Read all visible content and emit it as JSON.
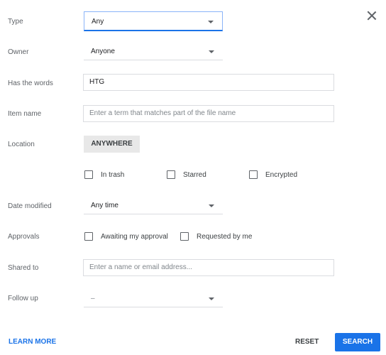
{
  "close_icon": "close-icon",
  "fields": {
    "type": {
      "label": "Type",
      "value": "Any"
    },
    "owner": {
      "label": "Owner",
      "value": "Anyone"
    },
    "has_words": {
      "label": "Has the words",
      "value": "HTG"
    },
    "item_name": {
      "label": "Item name",
      "placeholder": "Enter a term that matches part of the file name"
    },
    "location": {
      "label": "Location",
      "value": "ANYWHERE"
    },
    "location_options": [
      "In trash",
      "Starred",
      "Encrypted"
    ],
    "date_modified": {
      "label": "Date modified",
      "value": "Any time"
    },
    "approvals": {
      "label": "Approvals",
      "options": [
        "Awaiting my approval",
        "Requested by me"
      ]
    },
    "shared_to": {
      "label": "Shared to",
      "placeholder": "Enter a name or email address..."
    },
    "follow_up": {
      "label": "Follow up",
      "value": "–"
    }
  },
  "footer": {
    "learn_more": "LEARN MORE",
    "reset": "RESET",
    "search": "SEARCH"
  }
}
